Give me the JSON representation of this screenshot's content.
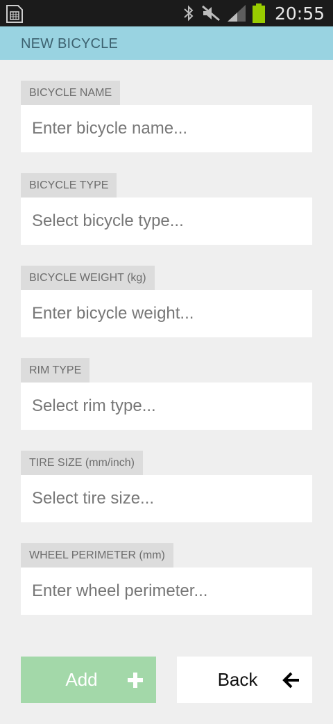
{
  "status_bar": {
    "time": "20:55",
    "icons": [
      "sim-card-icon",
      "bluetooth-icon",
      "mute-icon",
      "signal-icon",
      "battery-icon"
    ],
    "battery_color": "#99cc00"
  },
  "app_bar": {
    "title": "NEW BICYCLE",
    "background": "#99d3e1"
  },
  "form": {
    "fields": [
      {
        "label": "BICYCLE NAME",
        "placeholder": "Enter bicycle name..."
      },
      {
        "label": "BICYCLE TYPE",
        "placeholder": "Select bicycle type..."
      },
      {
        "label": "BICYCLE WEIGHT (kg)",
        "placeholder": "Enter bicycle weight..."
      },
      {
        "label": "RIM TYPE",
        "placeholder": "Select rim type..."
      },
      {
        "label": "TIRE SIZE (mm/inch)",
        "placeholder": "Select tire size..."
      },
      {
        "label": "WHEEL PERIMETER (mm)",
        "placeholder": "Enter wheel perimeter..."
      }
    ]
  },
  "buttons": {
    "add": {
      "label": "Add",
      "icon": "plus-icon",
      "color": "#a3d8a9"
    },
    "back": {
      "label": "Back",
      "icon": "arrow-left-icon"
    }
  }
}
